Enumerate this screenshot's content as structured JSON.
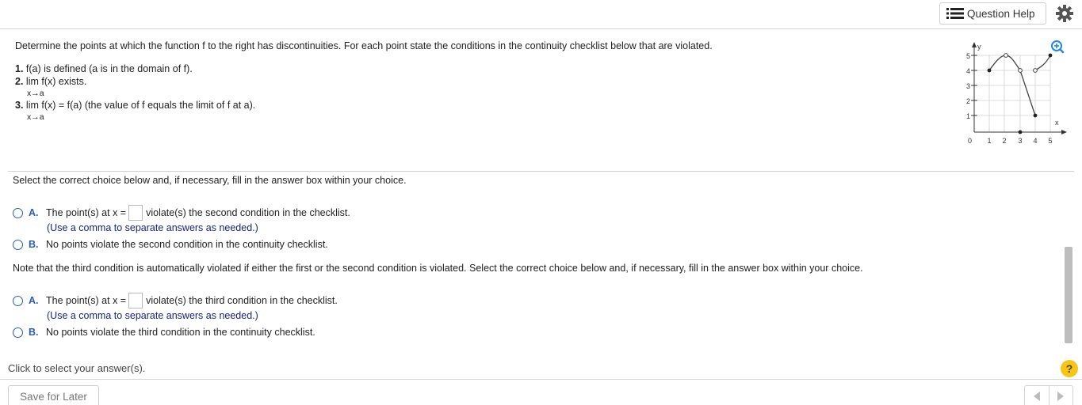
{
  "header": {
    "question_help_label": "Question Help",
    "settings_icon": "gear-icon",
    "help_list_icon": "list-icon"
  },
  "problem": {
    "prompt": "Determine the points at which the function f to the right has discontinuities. For each point state the conditions in the continuity checklist below that are violated.",
    "checklist": [
      {
        "num": "1.",
        "text": "f(a) is defined (a is in the domain of f)."
      },
      {
        "num": "2.",
        "text": "lim  f(x) exists.",
        "sub": "x→a"
      },
      {
        "num": "3.",
        "text": "lim  f(x) = f(a) (the value of f equals the limit of f at a).",
        "sub": "x→a"
      }
    ]
  },
  "graph": {
    "y_axis_label": "y",
    "x_axis_label": "x",
    "origin_label": "0",
    "y_ticks": [
      "1",
      "2",
      "3",
      "4",
      "5"
    ],
    "x_ticks": [
      "1",
      "2",
      "3",
      "4",
      "5"
    ],
    "zoom_icon": "zoom-in-icon"
  },
  "part1": {
    "instruction": "Select the correct choice below and, if necessary, fill in the answer box within your choice.",
    "choice_a_letter": "A.",
    "choice_a_pre": "The point(s) at x =",
    "choice_a_post": "violate(s) the second condition in the checklist.",
    "choice_a_hint": "(Use a comma to separate answers as needed.)",
    "choice_b_letter": "B.",
    "choice_b_text": "No points violate the second condition in the continuity checklist."
  },
  "part2": {
    "instruction": "Note that the third condition is automatically violated if either the first or the second condition is violated. Select the correct choice below and, if necessary, fill in the answer box within your choice.",
    "choice_a_letter": "A.",
    "choice_a_pre": "The point(s) at x =",
    "choice_a_post": "violate(s) the third condition in the checklist.",
    "choice_a_hint": "(Use a comma to separate answers as needed.)",
    "choice_b_letter": "B.",
    "choice_b_text": "No points violate the third condition in the continuity checklist."
  },
  "status_text": "Click to select your answer(s).",
  "help_glyph": "?",
  "footer": {
    "save_label": "Save for Later",
    "prev_icon": "triangle-left-icon",
    "next_icon": "triangle-right-icon"
  },
  "colors": {
    "accent": "#2a5db0",
    "hint": "#1a237e",
    "zoom": "#1e88e5",
    "help": "#f5c518"
  }
}
